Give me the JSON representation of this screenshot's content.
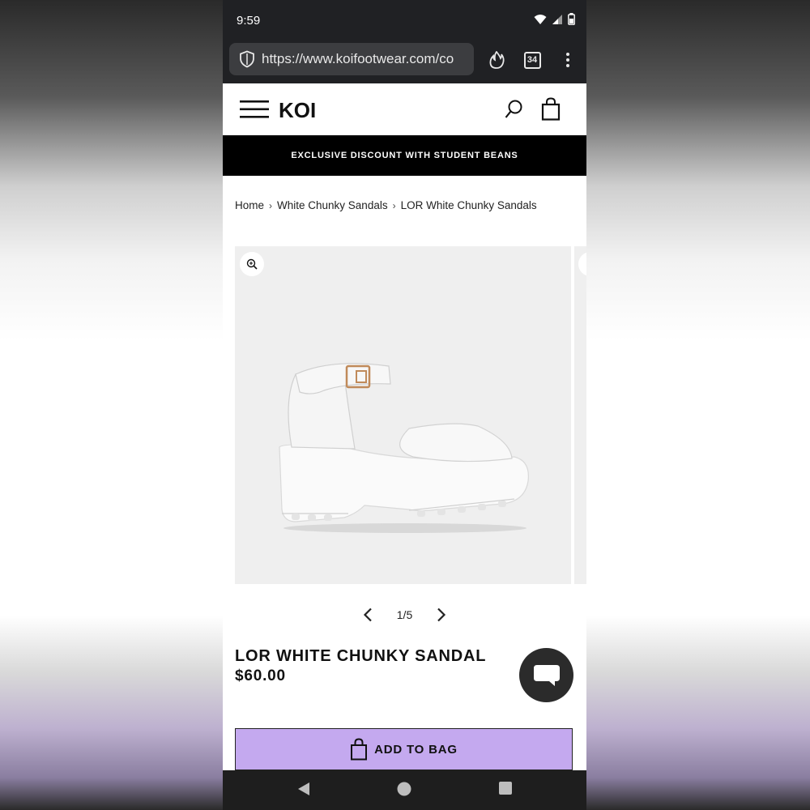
{
  "status_bar": {
    "time": "9:59"
  },
  "browser": {
    "url": "https://www.koifootwear.com/co",
    "tab_count": "34"
  },
  "site": {
    "logo": "KOI",
    "promo": "EXCLUSIVE DISCOUNT WITH STUDENT BEANS"
  },
  "breadcrumb": {
    "items": [
      "Home",
      "White Chunky Sandals",
      "LOR White Chunky Sandals"
    ],
    "separator": "›"
  },
  "gallery": {
    "pager": "1/5"
  },
  "product": {
    "title": "LOR WHITE CHUNKY SANDAL",
    "price": "$60.00"
  },
  "actions": {
    "add_to_bag": "ADD TO BAG"
  },
  "colors": {
    "accent": "#c4a9ef",
    "promo_bg": "#000000",
    "chrome_bg": "#202124"
  }
}
